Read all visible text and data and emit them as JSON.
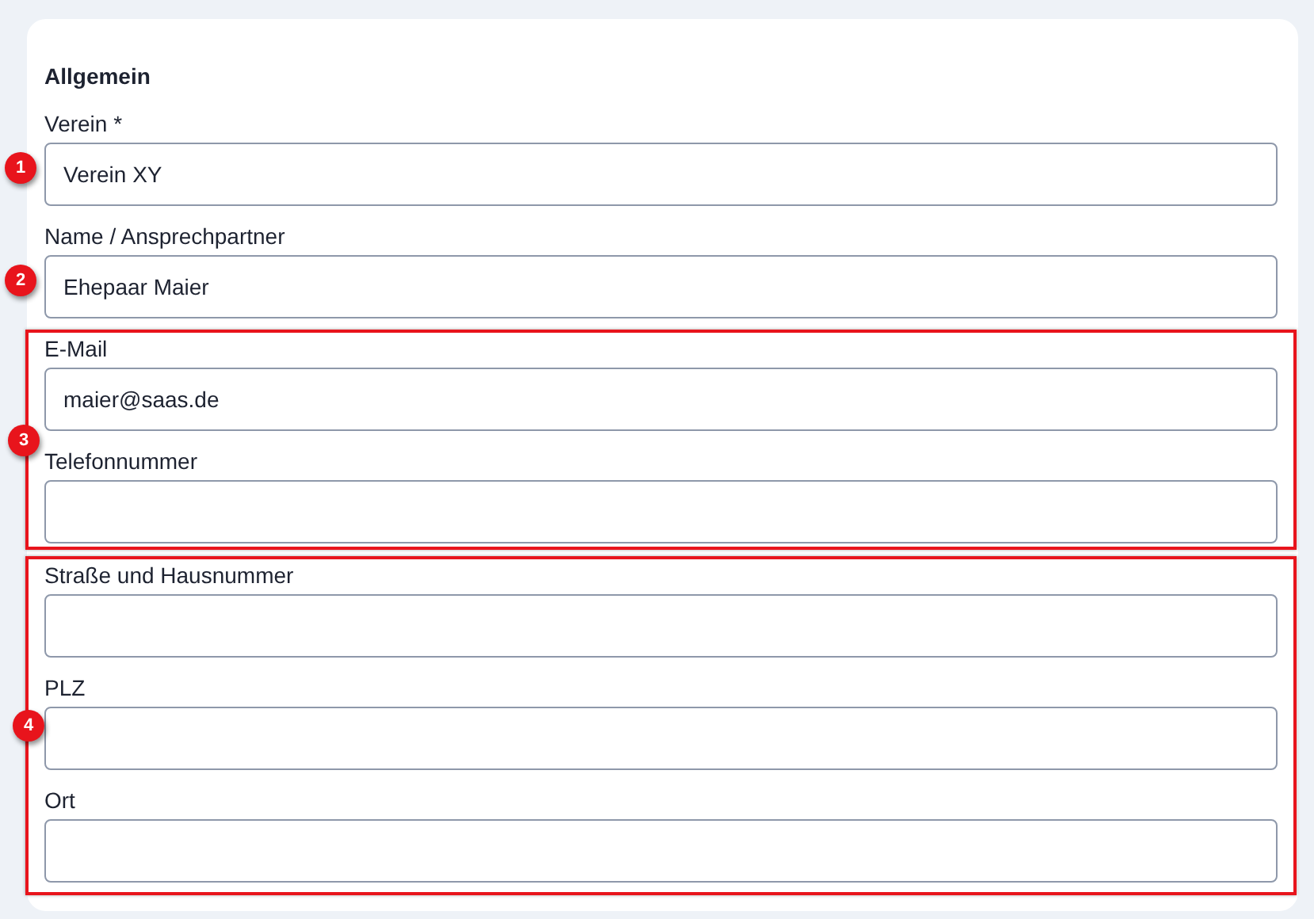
{
  "section_title": "Allgemein",
  "groups": [
    {
      "badge": "1",
      "highlighted": false,
      "fields": [
        {
          "label": "Verein",
          "required_marker": "*",
          "value": "Verein XY"
        }
      ]
    },
    {
      "badge": "2",
      "highlighted": false,
      "fields": [
        {
          "label": "Name / Ansprechpartner",
          "value": "Ehepaar Maier"
        }
      ]
    },
    {
      "badge": "3",
      "highlighted": true,
      "fields": [
        {
          "label": "E-Mail",
          "value": "maier@saas.de"
        },
        {
          "label": "Telefonnummer"
        }
      ]
    },
    {
      "badge": "4",
      "highlighted": true,
      "fields": [
        {
          "label": "Straße und Hausnummer"
        },
        {
          "label": "PLZ"
        },
        {
          "label": "Ort"
        }
      ]
    }
  ]
}
